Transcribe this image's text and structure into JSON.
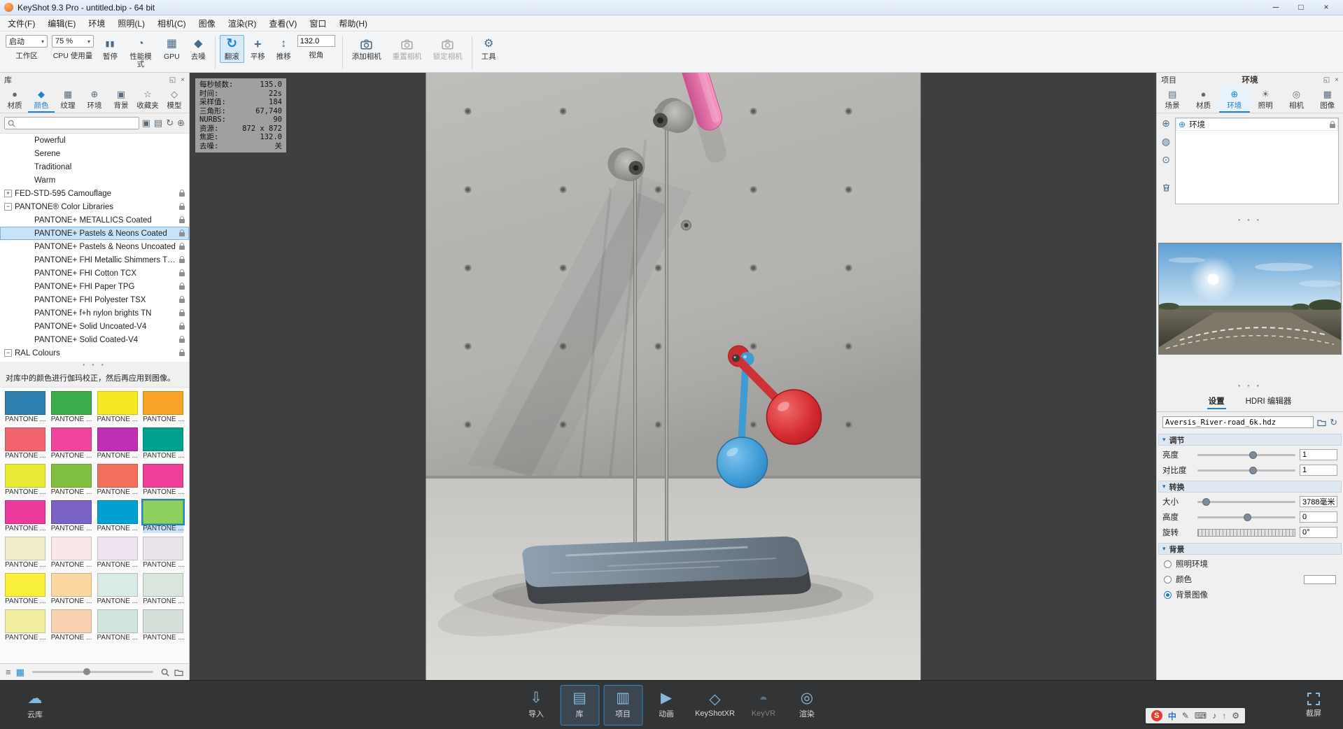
{
  "titlebar": {
    "title": "KeyShot 9.3 Pro - untitled.bip - 64 bit",
    "minimize": "─",
    "maximize": "□",
    "close": "×"
  },
  "menubar": {
    "items": [
      "文件(F)",
      "编辑(E)",
      "环境",
      "照明(L)",
      "相机(C)",
      "图像",
      "渲染(R)",
      "查看(V)",
      "窗口",
      "帮助(H)"
    ]
  },
  "toolbar": {
    "workspace": {
      "value": "启动",
      "label": "工作区"
    },
    "cpu": {
      "value": "75 %",
      "label": "CPU 使用量"
    },
    "pause": {
      "label": "暂停",
      "glyph": "▮▮"
    },
    "performance": {
      "label": "性能模式",
      "glyph": "◔"
    },
    "gpu": {
      "label": "GPU",
      "glyph": "▦"
    },
    "denoise": {
      "label": "去噪",
      "glyph": "◆"
    },
    "tumble": {
      "label": "翻滚",
      "glyph": "↻"
    },
    "pan": {
      "label": "平移",
      "glyph": "+"
    },
    "dolly": {
      "label": "推移",
      "glyph": "↕"
    },
    "fov": {
      "label": "视角",
      "value": "132.0"
    },
    "add_camera": {
      "label": "添加相机"
    },
    "reset_camera": {
      "label": "重置相机"
    },
    "lock_camera": {
      "label": "锁定相机"
    },
    "tools": {
      "label": "工具",
      "glyph": "⚙"
    }
  },
  "ui": {
    "caret": "▾",
    "dots": "● ● ●",
    "float_icon": "◱",
    "close_icon": "×"
  },
  "library": {
    "title": "库",
    "tabs": [
      {
        "label": "材质",
        "glyph": "●",
        "name": "tab-materials"
      },
      {
        "label": "颜色",
        "glyph": "◆",
        "name": "tab-colors",
        "cls": "active"
      },
      {
        "label": "纹理",
        "glyph": "▦",
        "name": "tab-textures"
      },
      {
        "label": "环境",
        "glyph": "⊕",
        "name": "tab-environments"
      },
      {
        "label": "背景",
        "glyph": "▣",
        "name": "tab-backplates"
      },
      {
        "label": "收藏夹",
        "glyph": "☆",
        "name": "tab-favorites"
      },
      {
        "label": "模型",
        "glyph": "◇",
        "name": "tab-models"
      }
    ],
    "search_icons": [
      {
        "glyph": "▣",
        "name": "add-folder-icon"
      },
      {
        "glyph": "▤",
        "name": "link-folder-icon"
      },
      {
        "glyph": "↻",
        "name": "refresh-icon"
      },
      {
        "glyph": "⊕",
        "name": "locate-icon"
      }
    ],
    "footer": {
      "list_glyph": "≡",
      "grid_glyph": "▦"
    },
    "tree": [
      {
        "label": "Powerful",
        "ind": "34px"
      },
      {
        "label": "Serene",
        "ind": "34px"
      },
      {
        "label": "Traditional",
        "ind": "34px"
      },
      {
        "label": "Warm",
        "ind": "34px"
      },
      {
        "label": "FED-STD-595 Camouflage",
        "ind": "6px",
        "exp": "+",
        "lock": "visible"
      },
      {
        "label": "PANTONE® Color Libraries",
        "ind": "6px",
        "exp": "−",
        "lock": "visible"
      },
      {
        "label": "PANTONE+ METALLICS Coated",
        "ind": "34px",
        "lock": "visible"
      },
      {
        "label": "PANTONE+ Pastels & Neons Coated",
        "ind": "34px",
        "lock": "visible",
        "cls": "selected"
      },
      {
        "label": "PANTONE+ Pastels & Neons Uncoated",
        "ind": "34px",
        "lock": "visible"
      },
      {
        "label": "PANTONE+ FHI Metallic Shimmers TPM",
        "ind": "34px",
        "lock": "visible"
      },
      {
        "label": "PANTONE+ FHI Cotton TCX",
        "ind": "34px",
        "lock": "visible"
      },
      {
        "label": "PANTONE+ FHI Paper TPG",
        "ind": "34px",
        "lock": "visible"
      },
      {
        "label": "PANTONE+ FHI Polyester TSX",
        "ind": "34px",
        "lock": "visible"
      },
      {
        "label": "PANTONE+ f+h nylon brights TN",
        "ind": "34px",
        "lock": "visible"
      },
      {
        "label": "PANTONE+ Solid Uncoated-V4",
        "ind": "34px",
        "lock": "visible"
      },
      {
        "label": "PANTONE+ Solid Coated-V4",
        "ind": "34px",
        "lock": "visible"
      },
      {
        "label": "RAL Colours",
        "ind": "6px",
        "exp": "−",
        "lock": "visible"
      }
    ],
    "gamma_note": "对库中的颜色进行伽玛校正，然后再应用到图像。",
    "swatches": [
      {
        "label": "PANTONE ...",
        "color": "#2d7fb0"
      },
      {
        "label": "PANTONE ...",
        "color": "#3cae4c"
      },
      {
        "label": "PANTONE ...",
        "color": "#f7e921"
      },
      {
        "label": "PANTONE ...",
        "color": "#f6a529"
      },
      {
        "label": "PANTONE ...",
        "color": "#f2636e"
      },
      {
        "label": "PANTONE ...",
        "color": "#f0459d"
      },
      {
        "label": "PANTONE ...",
        "color": "#bf2fb5"
      },
      {
        "label": "PANTONE ...",
        "color": "#00a28d"
      },
      {
        "label": "PANTONE ...",
        "color": "#e9ea36"
      },
      {
        "label": "PANTONE ...",
        "color": "#7fc043"
      },
      {
        "label": "PANTONE ...",
        "color": "#f3705c"
      },
      {
        "label": "PANTONE ...",
        "color": "#ee3e97"
      },
      {
        "label": "PANTONE ...",
        "color": "#ea3a9b"
      },
      {
        "label": "PANTONE ...",
        "color": "#7a62c6"
      },
      {
        "label": "PANTONE ...",
        "color": "#00a0d2"
      },
      {
        "label": "PANTONE ...",
        "color": "#8ed05e",
        "cls": "selected"
      },
      {
        "label": "PANTONE ...",
        "color": "#f0edca"
      },
      {
        "label": "PANTONE ...",
        "color": "#f9e7e9"
      },
      {
        "label": "PANTONE ...",
        "color": "#ede4f0"
      },
      {
        "label": "PANTONE ...",
        "color": "#eae4ea"
      },
      {
        "label": "PANTONE ...",
        "color": "#f7ef3a"
      },
      {
        "label": "PANTONE ...",
        "color": "#fbd89f"
      },
      {
        "label": "PANTONE ...",
        "color": "#d9eae7"
      },
      {
        "label": "PANTONE ...",
        "color": "#dae6db"
      },
      {
        "label": "PANTONE ...",
        "color": "#f2f0a0"
      },
      {
        "label": "PANTONE ...",
        "color": "#f9d1b1"
      },
      {
        "label": "PANTONE ...",
        "color": "#d0e4e0"
      },
      {
        "label": "PANTONE ...",
        "color": "#d6e0d9"
      }
    ]
  },
  "viewport": {
    "stats": [
      {
        "label": "每秒帧数:",
        "value": "135.0"
      },
      {
        "label": "时间:",
        "value": "22s"
      },
      {
        "label": "采样值:",
        "value": "184"
      },
      {
        "label": "三角形:",
        "value": "67,740"
      },
      {
        "label": "NURBS:",
        "value": "90"
      },
      {
        "label": "资源:",
        "value": "872 x 872"
      },
      {
        "label": "焦距:",
        "value": "132.0"
      },
      {
        "label": "去噪:",
        "value": "关"
      }
    ],
    "render_colors": {
      "pink": "#e26fa6",
      "teal": "#35b396",
      "red": "#ce3136",
      "blue": "#3f9bd4"
    }
  },
  "project": {
    "name": "项目",
    "title": "环境",
    "tabs": [
      {
        "label": "场景",
        "glyph": "▤",
        "name": "tab-scene"
      },
      {
        "label": "材质",
        "glyph": "●",
        "name": "tab-material"
      },
      {
        "label": "环境",
        "glyph": "⊕",
        "name": "tab-environment",
        "cls": "active"
      },
      {
        "label": "照明",
        "glyph": "☀",
        "name": "tab-lighting"
      },
      {
        "label": "相机",
        "glyph": "◎",
        "name": "tab-camera"
      },
      {
        "label": "图像",
        "glyph": "▦",
        "name": "tab-image"
      }
    ],
    "env_strip": [
      {
        "glyph": "⊕",
        "name": "add-environment-icon"
      },
      {
        "glyph": "◍",
        "name": "duplicate-environment-icon"
      },
      {
        "glyph": "⊙",
        "name": "export-environment-icon"
      }
    ],
    "env_item": "环境",
    "settings_tabs": [
      {
        "label": "设置",
        "cls": "active"
      },
      {
        "label": "HDRI 编辑器"
      }
    ],
    "hdri_file": "Aversis_River-road_6k.hdz",
    "sections": {
      "adjust": "调节",
      "transform": "转换",
      "background": "背景"
    },
    "sliders": {
      "brightness": {
        "label": "亮度",
        "value": "1"
      },
      "contrast": {
        "label": "对比度",
        "value": "1"
      },
      "size": {
        "label": "大小",
        "value": "3788毫米"
      },
      "height": {
        "label": "高度",
        "value": "0"
      },
      "rotation": {
        "label": "旋转",
        "value": "0°"
      }
    },
    "background_options": [
      {
        "label": "照明环境"
      },
      {
        "label": "颜色"
      },
      {
        "label": "背景图像"
      }
    ]
  },
  "dock": {
    "cloud": {
      "label": "云库",
      "glyph": "☁"
    },
    "items": [
      {
        "label": "导入",
        "glyph": "⇩",
        "name": "dock-import"
      },
      {
        "label": "库",
        "glyph": "▤",
        "name": "dock-library",
        "cls": "active"
      },
      {
        "label": "项目",
        "glyph": "▥",
        "name": "dock-project",
        "cls": "active"
      },
      {
        "label": "动画",
        "glyph": "▶",
        "name": "dock-animation"
      },
      {
        "label": "KeyShotXR",
        "glyph": "◇",
        "name": "dock-keyshotxr"
      },
      {
        "label": "KeyVR",
        "glyph": "◓",
        "name": "dock-keyvr",
        "cls": "disabled"
      },
      {
        "label": "渲染",
        "glyph": "◎",
        "name": "dock-render"
      }
    ],
    "screenshot": {
      "label": "截屏"
    },
    "tray": [
      {
        "glyph": "S",
        "cls": "sogou",
        "name": "sogou-icon"
      },
      {
        "glyph": "中",
        "cls": "zh",
        "name": "chinese-mode-icon"
      },
      {
        "glyph": "✎",
        "name": "handwriting-icon"
      },
      {
        "glyph": "⌨",
        "name": "keyboard-icon"
      },
      {
        "glyph": "♪",
        "name": "sound-icon"
      },
      {
        "glyph": "↑",
        "cls": "zh",
        "name": "update-icon"
      },
      {
        "glyph": "⚙",
        "name": "settings-icon"
      }
    ]
  }
}
